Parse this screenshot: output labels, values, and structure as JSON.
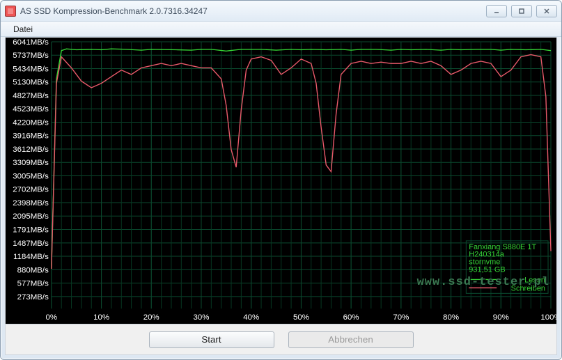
{
  "window": {
    "title": "AS SSD Kompression-Benchmark 2.0.7316.34247"
  },
  "menu": {
    "file": "Datei"
  },
  "buttons": {
    "start": "Start",
    "cancel": "Abbrechen"
  },
  "legend": {
    "device": "Fanxiang S880E 1T",
    "firmware": "H240314a",
    "driver": "stornvme",
    "capacity": "931,51 GB",
    "read": "Lesen",
    "write": "Schreiben"
  },
  "watermark": "www.ssd-tester.pl",
  "chart_data": {
    "type": "line",
    "xlabel": "",
    "ylabel": "",
    "title": "",
    "x_unit": "%",
    "y_unit": "MB/s",
    "xlim": [
      0,
      100
    ],
    "ylim": [
      0,
      6041
    ],
    "x_ticks": [
      0,
      10,
      20,
      30,
      40,
      50,
      60,
      70,
      80,
      90,
      100
    ],
    "y_ticks": [
      273,
      577,
      880,
      1184,
      1487,
      1791,
      2095,
      2398,
      2702,
      3005,
      3309,
      3612,
      3916,
      4220,
      4523,
      4827,
      5130,
      5434,
      5737,
      6041
    ],
    "series": [
      {
        "name": "Lesen",
        "color": "#35d335",
        "x": [
          0,
          1,
          2,
          3,
          5,
          8,
          10,
          12,
          15,
          18,
          20,
          25,
          28,
          30,
          32,
          35,
          38,
          40,
          42,
          45,
          48,
          50,
          52,
          55,
          58,
          60,
          62,
          65,
          68,
          70,
          72,
          75,
          78,
          80,
          82,
          85,
          88,
          90,
          92,
          95,
          98,
          100
        ],
        "y": [
          900,
          5200,
          5840,
          5880,
          5860,
          5870,
          5860,
          5880,
          5870,
          5850,
          5870,
          5860,
          5850,
          5870,
          5870,
          5830,
          5870,
          5870,
          5870,
          5850,
          5870,
          5860,
          5870,
          5860,
          5870,
          5850,
          5870,
          5870,
          5850,
          5870,
          5860,
          5870,
          5850,
          5870,
          5860,
          5870,
          5870,
          5850,
          5870,
          5860,
          5870,
          5840
        ]
      },
      {
        "name": "Schreiben",
        "color": "#e85a6a",
        "x": [
          0,
          1,
          2,
          4,
          6,
          8,
          10,
          12,
          14,
          16,
          18,
          20,
          22,
          24,
          26,
          28,
          30,
          32,
          34,
          35,
          36,
          37,
          38,
          39,
          40,
          42,
          44,
          46,
          48,
          50,
          52,
          53,
          54,
          55,
          56,
          57,
          58,
          60,
          62,
          64,
          66,
          68,
          70,
          72,
          74,
          76,
          78,
          80,
          82,
          84,
          86,
          88,
          90,
          92,
          94,
          96,
          98,
          99,
          100
        ],
        "y": [
          900,
          5100,
          5700,
          5450,
          5150,
          5000,
          5100,
          5250,
          5400,
          5300,
          5450,
          5500,
          5550,
          5500,
          5550,
          5500,
          5450,
          5450,
          5200,
          4600,
          3600,
          3200,
          4500,
          5400,
          5650,
          5700,
          5620,
          5300,
          5450,
          5650,
          5550,
          5100,
          4100,
          3250,
          3100,
          4400,
          5300,
          5550,
          5600,
          5550,
          5580,
          5550,
          5550,
          5600,
          5550,
          5600,
          5500,
          5300,
          5400,
          5550,
          5600,
          5550,
          5250,
          5400,
          5700,
          5750,
          5700,
          4800,
          1300
        ]
      }
    ]
  }
}
